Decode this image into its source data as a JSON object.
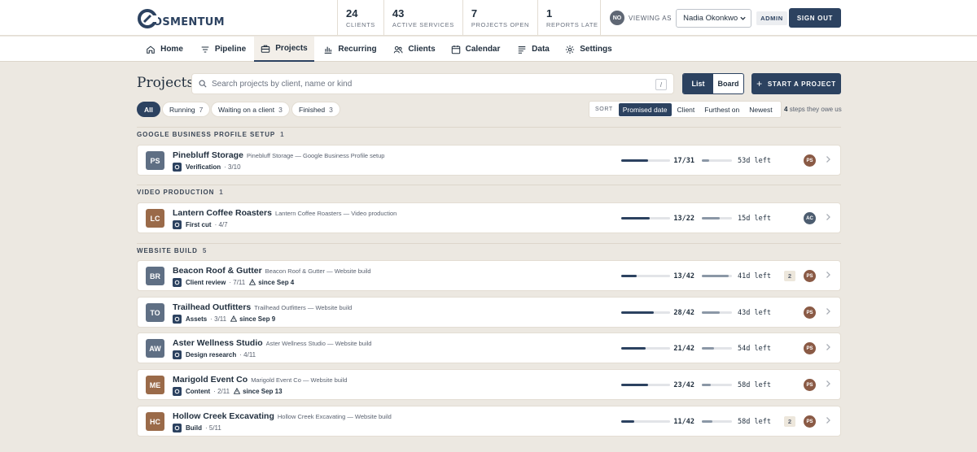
{
  "app": {
    "brand": "OSMENTUM",
    "brand_initial": "C"
  },
  "stats": [
    {
      "num": "24",
      "label": "CLIENTS"
    },
    {
      "num": "43",
      "label": "ACTIVE SERVICES"
    },
    {
      "num": "7",
      "label": "PROJECTS OPEN"
    },
    {
      "num": "1",
      "label": "REPORTS LATE"
    }
  ],
  "user": {
    "initials": "NO",
    "viewing_as": "VIEWING AS",
    "name": "Nadia Okonkwo",
    "role": "ADMIN",
    "signout": "SIGN OUT"
  },
  "nav": [
    {
      "label": "Home",
      "icon": "home-icon"
    },
    {
      "label": "Pipeline",
      "icon": "funnel-icon"
    },
    {
      "label": "Projects",
      "icon": "briefcase-icon",
      "active": true
    },
    {
      "label": "Recurring",
      "icon": "bar-chart-icon"
    },
    {
      "label": "Clients",
      "icon": "users-icon"
    },
    {
      "label": "Calendar",
      "icon": "calendar-icon"
    },
    {
      "label": "Data",
      "icon": "lines-icon"
    },
    {
      "label": "Settings",
      "icon": "gear-icon"
    }
  ],
  "page": {
    "title": "Projects",
    "search_placeholder": "Search projects by client, name or kind",
    "shortcut": "/",
    "view_list": "List",
    "view_board": "Board",
    "start_label": "START A PROJECT"
  },
  "filters": [
    {
      "label": "All",
      "count": "",
      "active": true
    },
    {
      "label": "Running",
      "count": "7"
    },
    {
      "label": "Waiting on a client",
      "count": "3"
    },
    {
      "label": "Finished",
      "count": "3"
    }
  ],
  "sort": {
    "label": "SORT",
    "options": [
      "Promised date",
      "Client",
      "Furthest on",
      "Newest"
    ],
    "active": "Promised date"
  },
  "owe": {
    "count": "4",
    "text": "steps they owe us"
  },
  "groups": [
    {
      "title": "GOOGLE BUSINESS PROFILE SETUP",
      "count": "1",
      "rows": [
        {
          "initials": "PS",
          "color": "#5f6f84",
          "name": "Pinebluff Storage",
          "sub": "Pinebluff Storage — Google Business Profile setup",
          "step": "Verification",
          "step_num": "3/10",
          "since": "",
          "fraction": "17/31",
          "progress": 0.55,
          "time_progress": 0.25,
          "left": "53d left",
          "badge": "",
          "owner": "PS",
          "owner_color": "#8a5a45"
        }
      ]
    },
    {
      "title": "VIDEO PRODUCTION",
      "count": "1",
      "rows": [
        {
          "initials": "LC",
          "color": "#9a6a49",
          "name": "Lantern Coffee Roasters",
          "sub": "Lantern Coffee Roasters — Video production",
          "step": "First cut",
          "step_num": "4/7",
          "since": "",
          "fraction": "13/22",
          "progress": 0.59,
          "time_progress": 0.6,
          "left": "15d left",
          "badge": "",
          "owner": "AC",
          "owner_color": "#4d5d70"
        }
      ]
    },
    {
      "title": "WEBSITE BUILD",
      "count": "5",
      "rows": [
        {
          "initials": "BR",
          "color": "#5f6f84",
          "name": "Beacon Roof & Gutter",
          "sub": "Beacon Roof & Gutter — Website build",
          "step": "Client review",
          "step_num": "7/11",
          "since": "since Sep 4",
          "fraction": "13/42",
          "progress": 0.31,
          "time_progress": 0.9,
          "left": "41d left",
          "badge": "2",
          "owner": "PS",
          "owner_color": "#8a5a45"
        },
        {
          "initials": "TO",
          "color": "#5f6f84",
          "name": "Trailhead Outfitters",
          "sub": "Trailhead Outfitters — Website build",
          "step": "Assets",
          "step_num": "3/11",
          "since": "since Sep 9",
          "fraction": "28/42",
          "progress": 0.67,
          "time_progress": 0.6,
          "left": "43d left",
          "badge": "",
          "owner": "PS",
          "owner_color": "#8a5a45"
        },
        {
          "initials": "AW",
          "color": "#5f6f84",
          "name": "Aster Wellness Studio",
          "sub": "Aster Wellness Studio — Website build",
          "step": "Design research",
          "step_num": "4/11",
          "since": "",
          "fraction": "21/42",
          "progress": 0.5,
          "time_progress": 0.4,
          "left": "54d left",
          "badge": "",
          "owner": "PS",
          "owner_color": "#8a5a45"
        },
        {
          "initials": "ME",
          "color": "#9a6a49",
          "name": "Marigold Event Co",
          "sub": "Marigold Event Co — Website build",
          "step": "Content",
          "step_num": "2/11",
          "since": "since Sep 13",
          "fraction": "23/42",
          "progress": 0.55,
          "time_progress": 0.3,
          "left": "58d left",
          "badge": "",
          "owner": "PS",
          "owner_color": "#8a5a45"
        },
        {
          "initials": "HC",
          "color": "#9a6a49",
          "name": "Hollow Creek Excavating",
          "sub": "Hollow Creek Excavating — Website build",
          "step": "Build",
          "step_num": "5/11",
          "since": "",
          "fraction": "11/42",
          "progress": 0.26,
          "time_progress": 0.35,
          "left": "58d left",
          "badge": "2",
          "owner": "PS",
          "owner_color": "#8a5a45"
        }
      ]
    }
  ]
}
